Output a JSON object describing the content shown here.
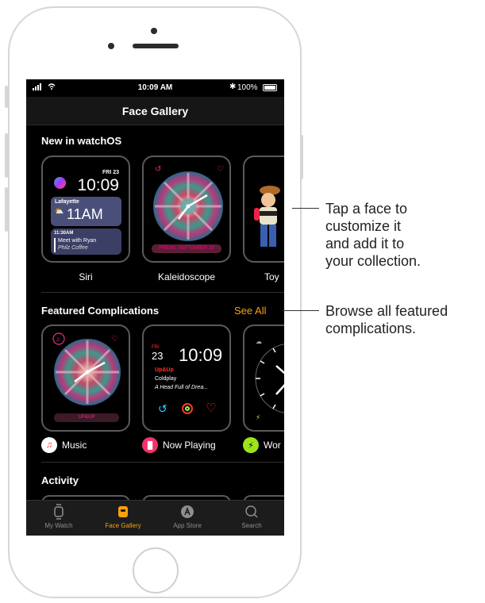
{
  "status_bar": {
    "time": "10:09 AM",
    "battery": "100%"
  },
  "nav": {
    "title": "Face Gallery"
  },
  "sections": {
    "new": "New in watchOS",
    "featured": "Featured Complications",
    "see_all": "See All",
    "activity": "Activity"
  },
  "new_faces": [
    {
      "label": "Siri",
      "date": "FRI 23",
      "time": "10:09",
      "location": "Lafayette",
      "temp": "11AM",
      "event_time": "11:30AM",
      "event_title": "Meet with Ryan",
      "event_place": "Philz Coffee"
    },
    {
      "label": "Kaleidoscope",
      "date_bar": "FRIDAY, SEPTEMBER 23"
    },
    {
      "label": "Toy"
    }
  ],
  "featured": [
    {
      "app": "Music",
      "bar_label": "UP&UP"
    },
    {
      "app": "Now Playing",
      "day": "FRI",
      "date": "23",
      "time": "10:09",
      "song": "Up&Up",
      "artist": "Coldplay",
      "album": "A Head Full of Drea..."
    },
    {
      "app": "Wor"
    }
  ],
  "tabs": [
    "My Watch",
    "Face Gallery",
    "App Store",
    "Search"
  ],
  "callouts": {
    "tap": [
      "Tap a face to",
      "customize it",
      "and add it to",
      "your collection."
    ],
    "browse": [
      "Browse all featured",
      "complications."
    ]
  },
  "colors": {
    "accent": "#ff9f0a",
    "background": "#000000"
  }
}
